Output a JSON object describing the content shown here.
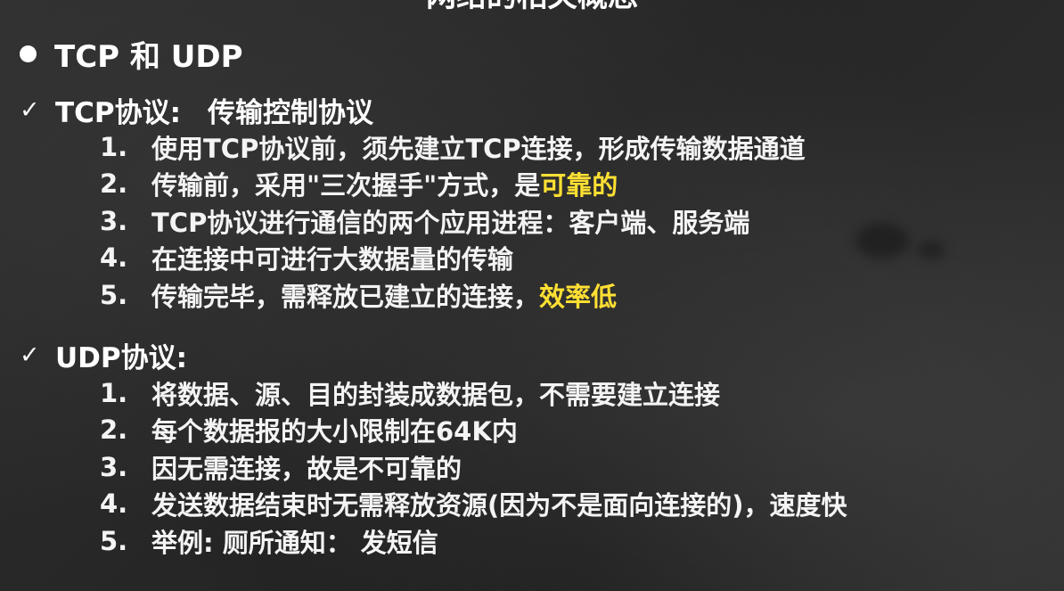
{
  "slide": {
    "top_title": "网络的相关概念",
    "heading": "TCP 和 UDP",
    "tcp": {
      "title_main": "TCP协议:",
      "title_sub": "传输控制协议",
      "items": [
        {
          "num": "1.",
          "text": "使用TCP协议前，须先建立TCP连接，形成传输数据通道",
          "highlight": ""
        },
        {
          "num": "2.",
          "text": "传输前，采用\"三次握手\"方式，是",
          "highlight": "可靠的"
        },
        {
          "num": "3.",
          "text": "TCP协议进行通信的两个应用进程：客户端、服务端",
          "highlight": ""
        },
        {
          "num": "4.",
          "text": "在连接中可进行大数据量的传输",
          "highlight": ""
        },
        {
          "num": "5.",
          "text": "传输完毕，需释放已建立的连接，",
          "highlight": "效率低"
        }
      ]
    },
    "udp": {
      "title_main": "UDP协议:",
      "items": [
        {
          "num": "1.",
          "text": "将数据、源、目的封装成数据包，不需要建立连接"
        },
        {
          "num": "2.",
          "text": "每个数据报的大小限制在64K内"
        },
        {
          "num": "3.",
          "text": "因无需连接，故是不可靠的"
        },
        {
          "num": "4.",
          "text": "发送数据结束时无需释放资源(因为不是面向连接的)，速度快"
        },
        {
          "num": "5.",
          "text": "举例: 厕所通知： 发短信"
        }
      ]
    },
    "colors": {
      "highlight": "#ffe033",
      "text": "#f4f4f4",
      "background": "#2b2b2b"
    }
  }
}
